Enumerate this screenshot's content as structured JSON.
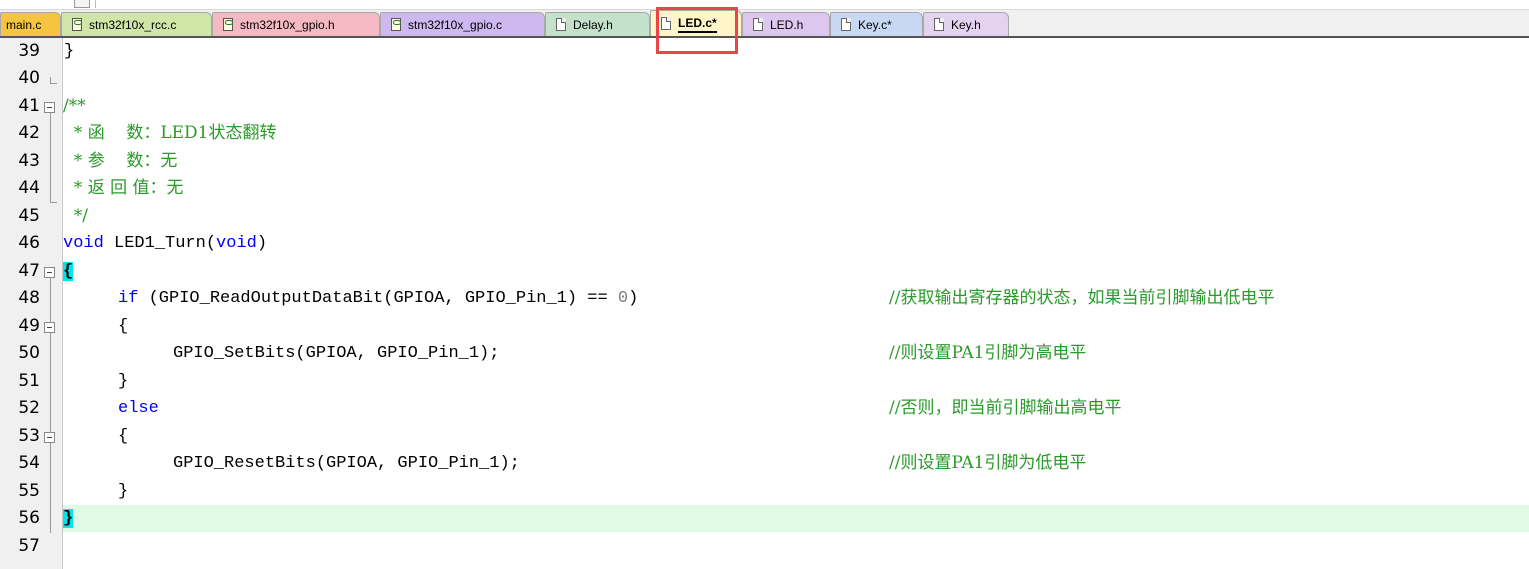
{
  "tabs": [
    {
      "label": "main.c",
      "type": "plain",
      "bg": "#f5c542"
    },
    {
      "label": "stm32f10x_rcc.c",
      "type": "cfile",
      "bg": "#cfe6a8"
    },
    {
      "label": "stm32f10x_gpio.h",
      "type": "cfile",
      "bg": "#f4b9c2"
    },
    {
      "label": "stm32f10x_gpio.c",
      "type": "cfile",
      "bg": "#cdb8ef"
    },
    {
      "label": "Delay.h",
      "type": "doc",
      "bg": "#c3e2c9"
    },
    {
      "label": "LED.c*",
      "type": "doc",
      "bg": "#fff5c8",
      "active": true
    },
    {
      "label": "LED.h",
      "type": "doc",
      "bg": "#dcc8ee"
    },
    {
      "label": "Key.c*",
      "type": "doc",
      "bg": "#c8d8f2"
    },
    {
      "label": "Key.h",
      "type": "doc",
      "bg": "#e3d3f0"
    }
  ],
  "editor": {
    "line_numbers": [
      "39",
      "40",
      "41",
      "42",
      "43",
      "44",
      "45",
      "46",
      "47",
      "48",
      "49",
      "50",
      "51",
      "52",
      "53",
      "54",
      "55",
      "56",
      "57"
    ],
    "current_line": "56",
    "lines": {
      "l39": {
        "text": "}"
      },
      "l40": {
        "text": ""
      },
      "l41": {
        "text": "/**"
      },
      "l42": {
        "text": "  * 函    数：LED1状态翻转"
      },
      "l43": {
        "text": "  * 参    数：无"
      },
      "l44": {
        "text": "  * 返 回 值：无"
      },
      "l45": {
        "text": "  */"
      },
      "l46": {
        "kw1": "void",
        "mid": " LED1_Turn(",
        "kw2": "void",
        "end": ")"
      },
      "l47": {
        "brace": "{"
      },
      "l48": {
        "kw": "if",
        "mid": " (GPIO_ReadOutputDataBit(GPIOA, GPIO_Pin_1) == ",
        "num": "0",
        "end": ")",
        "comment": "//获取输出寄存器的状态，如果当前引脚输出低电平"
      },
      "l49": {
        "text": "{"
      },
      "l50": {
        "text": "GPIO_SetBits(GPIOA, GPIO_Pin_1);",
        "comment": "//则设置PA1引脚为高电平"
      },
      "l51": {
        "text": "}"
      },
      "l52": {
        "kw": "else",
        "comment": "//否则，即当前引脚输出高电平"
      },
      "l53": {
        "text": "{"
      },
      "l54": {
        "text": "GPIO_ResetBits(GPIOA, GPIO_Pin_1);",
        "comment": "//则设置PA1引脚为低电平"
      },
      "l55": {
        "text": "}"
      },
      "l56": {
        "brace": "}"
      },
      "l57": {
        "text": ""
      }
    }
  },
  "colors": {
    "keyword": "#0000ff",
    "comment": "#2a9a2a",
    "number": "#7e7e7e",
    "current_line_bg": "#e0fbe3",
    "brace_match_bg": "#00e5e5",
    "highlight_box": "#e8464a"
  }
}
